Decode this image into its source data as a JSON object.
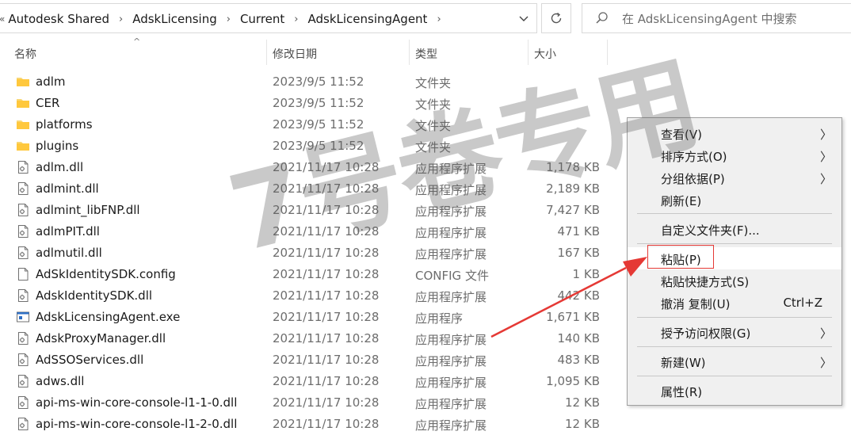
{
  "address_bar": {
    "lead": "«",
    "breadcrumbs": [
      "Autodesk Shared",
      "AdskLicensing",
      "Current",
      "AdskLicensingAgent"
    ]
  },
  "search": {
    "placeholder": "在 AdskLicensingAgent 中搜索"
  },
  "columns": {
    "name": "名称",
    "date": "修改日期",
    "type": "类型",
    "size": "大小"
  },
  "files": [
    {
      "name": "adlm",
      "date": "2023/9/5 11:52",
      "type": "文件夹",
      "size": "",
      "icon": "folder-icon"
    },
    {
      "name": "CER",
      "date": "2023/9/5 11:52",
      "type": "文件夹",
      "size": "",
      "icon": "folder-icon"
    },
    {
      "name": "platforms",
      "date": "2023/9/5 11:52",
      "type": "文件夹",
      "size": "",
      "icon": "folder-icon"
    },
    {
      "name": "plugins",
      "date": "2023/9/5 11:52",
      "type": "文件夹",
      "size": "",
      "icon": "folder-icon"
    },
    {
      "name": "adlm.dll",
      "date": "2021/11/17 10:28",
      "type": "应用程序扩展",
      "size": "1,178 KB",
      "icon": "dll-file-icon"
    },
    {
      "name": "adlmint.dll",
      "date": "2021/11/17 10:28",
      "type": "应用程序扩展",
      "size": "2,189 KB",
      "icon": "dll-file-icon"
    },
    {
      "name": "adlmint_libFNP.dll",
      "date": "2021/11/17 10:28",
      "type": "应用程序扩展",
      "size": "7,427 KB",
      "icon": "dll-file-icon"
    },
    {
      "name": "adlmPIT.dll",
      "date": "2021/11/17 10:28",
      "type": "应用程序扩展",
      "size": "471 KB",
      "icon": "dll-file-icon"
    },
    {
      "name": "adlmutil.dll",
      "date": "2021/11/17 10:28",
      "type": "应用程序扩展",
      "size": "167 KB",
      "icon": "dll-file-icon"
    },
    {
      "name": "AdSkIdentitySDK.config",
      "date": "2021/11/17 10:28",
      "type": "CONFIG 文件",
      "size": "1 KB",
      "icon": "config-file-icon"
    },
    {
      "name": "AdskIdentitySDK.dll",
      "date": "2021/11/17 10:28",
      "type": "应用程序扩展",
      "size": "442 KB",
      "icon": "dll-file-icon"
    },
    {
      "name": "AdskLicensingAgent.exe",
      "date": "2021/11/17 10:28",
      "type": "应用程序",
      "size": "1,671 KB",
      "icon": "exe-file-icon"
    },
    {
      "name": "AdskProxyManager.dll",
      "date": "2021/11/17 10:28",
      "type": "应用程序扩展",
      "size": "140 KB",
      "icon": "dll-file-icon"
    },
    {
      "name": "AdSSOServices.dll",
      "date": "2021/11/17 10:28",
      "type": "应用程序扩展",
      "size": "483 KB",
      "icon": "dll-file-icon"
    },
    {
      "name": "adws.dll",
      "date": "2021/11/17 10:28",
      "type": "应用程序扩展",
      "size": "1,095 KB",
      "icon": "dll-file-icon"
    },
    {
      "name": "api-ms-win-core-console-l1-1-0.dll",
      "date": "2021/11/17 10:28",
      "type": "应用程序扩展",
      "size": "12 KB",
      "icon": "dll-file-icon"
    },
    {
      "name": "api-ms-win-core-console-l1-2-0.dll",
      "date": "2021/11/17 10:28",
      "type": "应用程序扩展",
      "size": "12 KB",
      "icon": "dll-file-icon"
    }
  ],
  "context_menu": {
    "view": "查看(V)",
    "sort_by": "排序方式(O)",
    "group_by": "分组依据(P)",
    "refresh": "刷新(E)",
    "customize_folder": "自定义文件夹(F)...",
    "paste": "粘贴(P)",
    "paste_shortcut": "粘贴快捷方式(S)",
    "undo_copy": "撤消 复制(U)",
    "undo_copy_shortcut": "Ctrl+Z",
    "grant_access": "授予访问权限(G)",
    "new": "新建(W)",
    "properties": "属性(R)"
  },
  "watermark": "7号卷专用",
  "annotation_color": "#e53935"
}
